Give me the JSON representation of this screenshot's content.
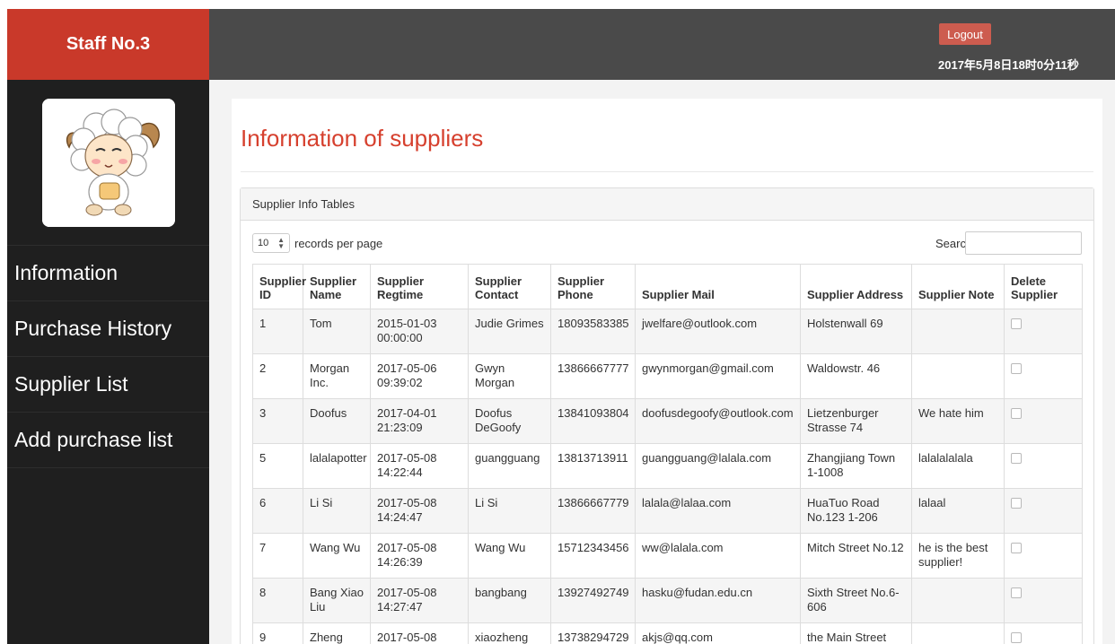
{
  "sidebar": {
    "brand": "Staff No.3",
    "nav": [
      "Information",
      "Purchase History",
      "Supplier List",
      "Add purchase list"
    ]
  },
  "topbar": {
    "logout": "Logout",
    "datetime": "2017年5月8日18时0分11秒"
  },
  "main": {
    "title": "Information of suppliers",
    "panel_title": "Supplier Info Tables",
    "length_value": "10",
    "length_label": "records per page",
    "search_label": "Search:",
    "search_value": "",
    "columns": [
      "Supplier ID",
      "Supplier Name",
      "Supplier Regtime",
      "Supplier Contact",
      "Supplier Phone",
      "Supplier Mail",
      "Supplier Address",
      "Supplier Note",
      "Delete Supplier"
    ],
    "rows": [
      [
        "1",
        "Tom",
        "2015-01-03 00:00:00",
        "Judie Grimes",
        "18093583385",
        "jwelfare@outlook.com",
        "Holstenwall 69",
        ""
      ],
      [
        "2",
        "Morgan Inc.",
        "2017-05-06 09:39:02",
        "Gwyn Morgan",
        "13866667777",
        "gwynmorgan@gmail.com",
        "Waldowstr. 46",
        ""
      ],
      [
        "3",
        "Doofus",
        "2017-04-01 21:23:09",
        "Doofus DeGoofy",
        "13841093804",
        "doofusdegoofy@outlook.com",
        "Lietzenburger Strasse 74",
        "We hate him"
      ],
      [
        "5",
        "lalalapotter",
        "2017-05-08 14:22:44",
        "guangguang",
        "13813713911",
        "guangguang@lalala.com",
        "Zhangjiang Town 1-1008",
        "lalalalalala"
      ],
      [
        "6",
        "Li Si",
        "2017-05-08 14:24:47",
        "Li Si",
        "13866667779",
        "lalala@lalaa.com",
        "HuaTuo Road No.123 1-206",
        "lalaal"
      ],
      [
        "7",
        "Wang Wu",
        "2017-05-08 14:26:39",
        "Wang Wu",
        "15712343456",
        "ww@lalala.com",
        "Mitch Street No.12",
        "he is the best supplier!"
      ],
      [
        "8",
        "Bang Xiao Liu",
        "2017-05-08 14:27:47",
        "bangbang",
        "13927492749",
        "hasku@fudan.edu.cn",
        "Sixth Street No.6-606",
        ""
      ],
      [
        "9",
        "Zheng Xiao",
        "2017-05-08",
        "xiaozheng",
        "13738294729",
        "akjs@qq.com",
        "the Main Street",
        ""
      ]
    ]
  },
  "icons": {
    "avatar": "sheep-cartoon-avatar",
    "select": "up-down-arrows-icon",
    "delete": "checkbox"
  },
  "colors": {
    "brand": "#c9392a",
    "title": "#d6402e",
    "logout": "#cd5c4f",
    "sidebar": "#1f1f1f",
    "topbar": "#4a4a4a"
  }
}
